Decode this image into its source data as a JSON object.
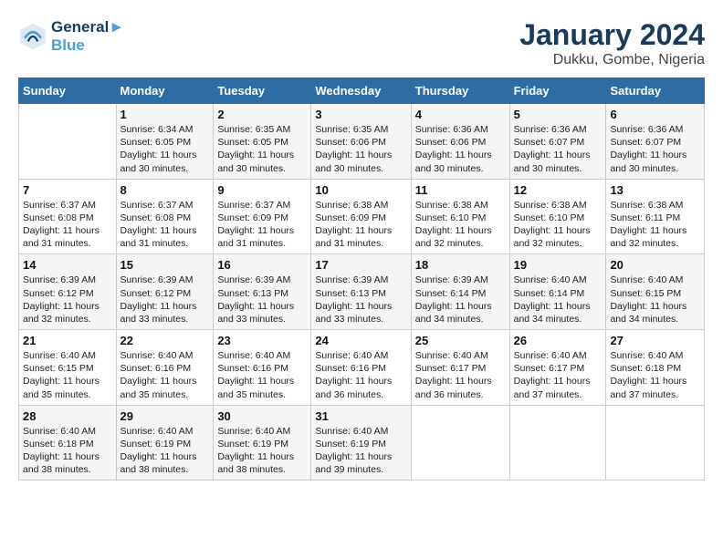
{
  "header": {
    "logo_line1": "General",
    "logo_line2": "Blue",
    "month_year": "January 2024",
    "location": "Dukku, Gombe, Nigeria"
  },
  "columns": [
    "Sunday",
    "Monday",
    "Tuesday",
    "Wednesday",
    "Thursday",
    "Friday",
    "Saturday"
  ],
  "weeks": [
    [
      {
        "day": "",
        "sunrise": "",
        "sunset": "",
        "daylight": ""
      },
      {
        "day": "1",
        "sunrise": "6:34 AM",
        "sunset": "6:05 PM",
        "daylight": "11 hours and 30 minutes."
      },
      {
        "day": "2",
        "sunrise": "6:35 AM",
        "sunset": "6:05 PM",
        "daylight": "11 hours and 30 minutes."
      },
      {
        "day": "3",
        "sunrise": "6:35 AM",
        "sunset": "6:06 PM",
        "daylight": "11 hours and 30 minutes."
      },
      {
        "day": "4",
        "sunrise": "6:36 AM",
        "sunset": "6:06 PM",
        "daylight": "11 hours and 30 minutes."
      },
      {
        "day": "5",
        "sunrise": "6:36 AM",
        "sunset": "6:07 PM",
        "daylight": "11 hours and 30 minutes."
      },
      {
        "day": "6",
        "sunrise": "6:36 AM",
        "sunset": "6:07 PM",
        "daylight": "11 hours and 30 minutes."
      }
    ],
    [
      {
        "day": "7",
        "sunrise": "6:37 AM",
        "sunset": "6:08 PM",
        "daylight": "11 hours and 31 minutes."
      },
      {
        "day": "8",
        "sunrise": "6:37 AM",
        "sunset": "6:08 PM",
        "daylight": "11 hours and 31 minutes."
      },
      {
        "day": "9",
        "sunrise": "6:37 AM",
        "sunset": "6:09 PM",
        "daylight": "11 hours and 31 minutes."
      },
      {
        "day": "10",
        "sunrise": "6:38 AM",
        "sunset": "6:09 PM",
        "daylight": "11 hours and 31 minutes."
      },
      {
        "day": "11",
        "sunrise": "6:38 AM",
        "sunset": "6:10 PM",
        "daylight": "11 hours and 32 minutes."
      },
      {
        "day": "12",
        "sunrise": "6:38 AM",
        "sunset": "6:10 PM",
        "daylight": "11 hours and 32 minutes."
      },
      {
        "day": "13",
        "sunrise": "6:38 AM",
        "sunset": "6:11 PM",
        "daylight": "11 hours and 32 minutes."
      }
    ],
    [
      {
        "day": "14",
        "sunrise": "6:39 AM",
        "sunset": "6:12 PM",
        "daylight": "11 hours and 32 minutes."
      },
      {
        "day": "15",
        "sunrise": "6:39 AM",
        "sunset": "6:12 PM",
        "daylight": "11 hours and 33 minutes."
      },
      {
        "day": "16",
        "sunrise": "6:39 AM",
        "sunset": "6:13 PM",
        "daylight": "11 hours and 33 minutes."
      },
      {
        "day": "17",
        "sunrise": "6:39 AM",
        "sunset": "6:13 PM",
        "daylight": "11 hours and 33 minutes."
      },
      {
        "day": "18",
        "sunrise": "6:39 AM",
        "sunset": "6:14 PM",
        "daylight": "11 hours and 34 minutes."
      },
      {
        "day": "19",
        "sunrise": "6:40 AM",
        "sunset": "6:14 PM",
        "daylight": "11 hours and 34 minutes."
      },
      {
        "day": "20",
        "sunrise": "6:40 AM",
        "sunset": "6:15 PM",
        "daylight": "11 hours and 34 minutes."
      }
    ],
    [
      {
        "day": "21",
        "sunrise": "6:40 AM",
        "sunset": "6:15 PM",
        "daylight": "11 hours and 35 minutes."
      },
      {
        "day": "22",
        "sunrise": "6:40 AM",
        "sunset": "6:16 PM",
        "daylight": "11 hours and 35 minutes."
      },
      {
        "day": "23",
        "sunrise": "6:40 AM",
        "sunset": "6:16 PM",
        "daylight": "11 hours and 35 minutes."
      },
      {
        "day": "24",
        "sunrise": "6:40 AM",
        "sunset": "6:16 PM",
        "daylight": "11 hours and 36 minutes."
      },
      {
        "day": "25",
        "sunrise": "6:40 AM",
        "sunset": "6:17 PM",
        "daylight": "11 hours and 36 minutes."
      },
      {
        "day": "26",
        "sunrise": "6:40 AM",
        "sunset": "6:17 PM",
        "daylight": "11 hours and 37 minutes."
      },
      {
        "day": "27",
        "sunrise": "6:40 AM",
        "sunset": "6:18 PM",
        "daylight": "11 hours and 37 minutes."
      }
    ],
    [
      {
        "day": "28",
        "sunrise": "6:40 AM",
        "sunset": "6:18 PM",
        "daylight": "11 hours and 38 minutes."
      },
      {
        "day": "29",
        "sunrise": "6:40 AM",
        "sunset": "6:19 PM",
        "daylight": "11 hours and 38 minutes."
      },
      {
        "day": "30",
        "sunrise": "6:40 AM",
        "sunset": "6:19 PM",
        "daylight": "11 hours and 38 minutes."
      },
      {
        "day": "31",
        "sunrise": "6:40 AM",
        "sunset": "6:19 PM",
        "daylight": "11 hours and 39 minutes."
      },
      {
        "day": "",
        "sunrise": "",
        "sunset": "",
        "daylight": ""
      },
      {
        "day": "",
        "sunrise": "",
        "sunset": "",
        "daylight": ""
      },
      {
        "day": "",
        "sunrise": "",
        "sunset": "",
        "daylight": ""
      }
    ]
  ],
  "labels": {
    "sunrise_prefix": "Sunrise: ",
    "sunset_prefix": "Sunset: ",
    "daylight_prefix": "Daylight: "
  }
}
